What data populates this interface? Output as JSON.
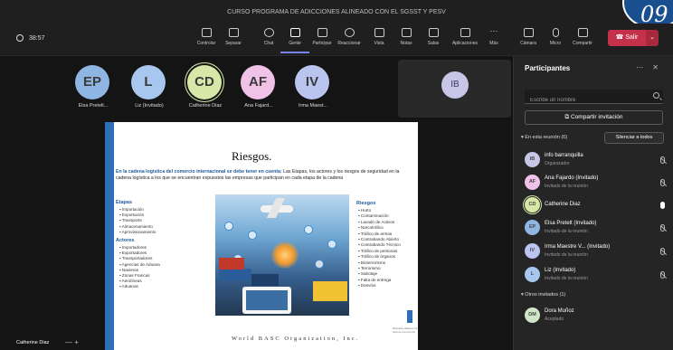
{
  "window": {
    "title": "CURSO PROGRAMA DE ADICCIONES ALINEADO CON EL SGSST Y PESV",
    "badge": "09"
  },
  "toolbar": {
    "timer": "38:57",
    "buttons": [
      {
        "label": "Controlar",
        "icon": "control-icon"
      },
      {
        "label": "Separar",
        "icon": "popout-icon"
      },
      {
        "label": "Chat",
        "icon": "chat-icon"
      },
      {
        "label": "Gente",
        "icon": "people-icon"
      },
      {
        "label": "Participar",
        "icon": "hand-icon"
      },
      {
        "label": "Reaccionar",
        "icon": "react-icon"
      },
      {
        "label": "Vista",
        "icon": "view-icon"
      },
      {
        "label": "Notas",
        "icon": "notes-icon"
      },
      {
        "label": "Salas",
        "icon": "rooms-icon"
      },
      {
        "label": "Aplicaciones",
        "icon": "apps-icon"
      },
      {
        "label": "Más",
        "icon": "more-icon"
      },
      {
        "label": "Cámara",
        "icon": "camera-icon"
      },
      {
        "label": "Micro",
        "icon": "mic-icon"
      },
      {
        "label": "Compartir",
        "icon": "share-icon"
      }
    ],
    "leave_label": "Salir",
    "accent": "#7b83eb",
    "leave_color": "#c4314b"
  },
  "video_tiles": [
    {
      "initials": "EP",
      "name": "Elsa Pretelt...",
      "color": "#8fb6e3"
    },
    {
      "initials": "L",
      "name": "Liz (Invitado)",
      "color": "#a8c7ef"
    },
    {
      "initials": "CD",
      "name": "Catherine Diaz",
      "color": "#d6e7a8"
    },
    {
      "initials": "AF",
      "name": "Ana Fajard...",
      "color": "#f1c2e8"
    },
    {
      "initials": "IV",
      "name": "Irma Maest...",
      "color": "#b9c4ef"
    }
  ],
  "ib_tile": {
    "initials": "IB"
  },
  "slide": {
    "title": "Riesgos.",
    "intro_bold": "En la cadena logística del comercio internacional se debe tener en cuenta:",
    "intro_rest": " Las Etapas, los actores y los riesgos de seguridad en la cadena logística a los que se encuentran expuestos las empresas que participan en cada etapa de la cadena",
    "etapas_title": "Etapas",
    "etapas": [
      "Importación",
      "Exportación",
      "Transporte",
      "Almacenamiento",
      "Aprovisionamiento"
    ],
    "actores_title": "Actores",
    "actores": [
      "Importadores",
      "Exportadores",
      "Transportadores",
      "Agencias de Aduana",
      "Navieras",
      "Zonas Francas",
      "Aerolíneas",
      "Aduanas"
    ],
    "riesgos_title": "Riesgos",
    "riesgos": [
      "Hurto",
      "Contaminación",
      "Lavado de Activos",
      "Narcotráfico",
      "Tráfico de armas",
      "Contrabando Abierto",
      "Contrabando Técnico",
      "Tráfico de personas",
      "Tráfico de órganos",
      "Bioterrorismo",
      "Terrorismo",
      "Sabotaje",
      "Falta de entrega",
      "Desvíos"
    ],
    "footer": "World BASC Organization, Inc.",
    "logo_text": "Business Alliance for Secure Commerce",
    "accent": "#2f6fb8"
  },
  "self_view": {
    "name": "Catherine Diaz",
    "controls": "— +"
  },
  "panel": {
    "title": "Participantes",
    "controls": "⋯ ✕",
    "search_placeholder": "Escribe un nombre",
    "share_label": "Compartir invitación",
    "in_meeting_label": "En esta reunión (6)",
    "silence_label": "Silenciar a todos",
    "participants": [
      {
        "initials": "IB",
        "name": "info barranquilla",
        "role": "Organizador",
        "color": "#c8c6e6",
        "mic": "off"
      },
      {
        "initials": "AF",
        "name": "Ana Fajardo (Invitado)",
        "role": "Invitado de la reunión",
        "color": "#f1c2e8",
        "mic": "off"
      },
      {
        "initials": "CD",
        "name": "Catherine Diaz",
        "role": "",
        "color": "#d6e7a8",
        "mic": "on"
      },
      {
        "initials": "EP",
        "name": "Elsa Pretelt (Invitado)",
        "role": "Invitado de la reunión",
        "color": "#8fb6e3",
        "mic": "off"
      },
      {
        "initials": "IV",
        "name": "Irma Maestre V... (Invitado)",
        "role": "Invitado de la reunión",
        "color": "#b9c4ef",
        "mic": "off"
      },
      {
        "initials": "L",
        "name": "Liz (Invitado)",
        "role": "Invitado de la reunión",
        "color": "#a8c7ef",
        "mic": "off"
      }
    ],
    "others_label": "Otros invitados (1)",
    "others": [
      {
        "initials": "DM",
        "name": "Dora Muñoz",
        "role": "Aceptado",
        "color": "#cfe6c9"
      }
    ]
  }
}
